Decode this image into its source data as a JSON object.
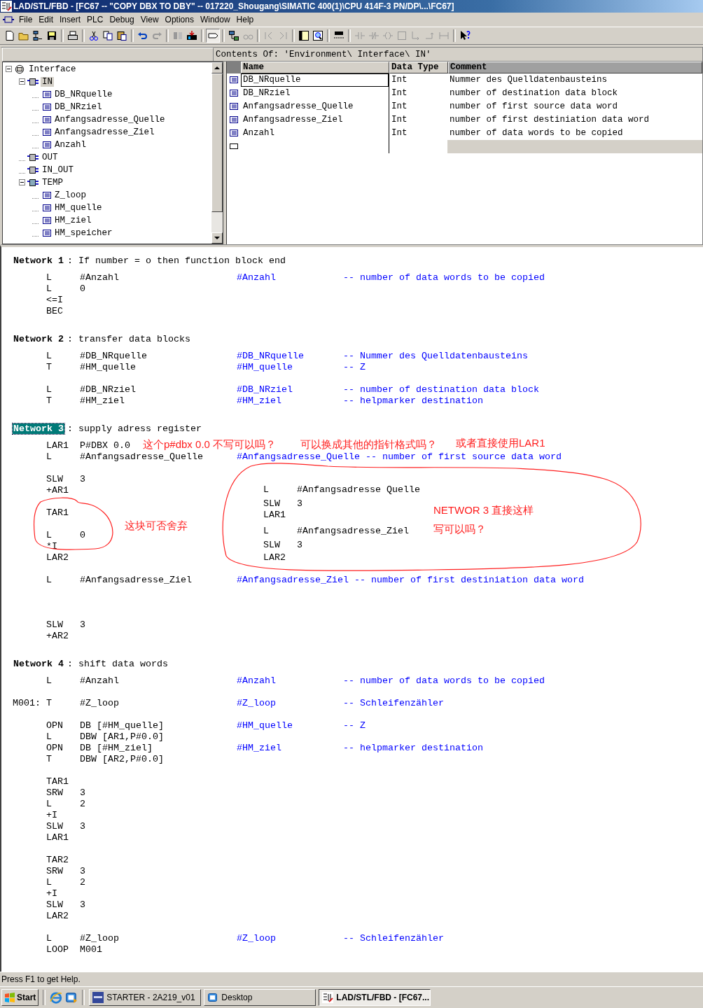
{
  "window": {
    "title": "LAD/STL/FBD  - [FC67 -- \"COPY DBX TO DBY\" -- 017220_Shougang\\SIMATIC 400(1)\\CPU 414F-3 PN/DP\\...\\FC67]"
  },
  "menu": [
    "File",
    "Edit",
    "Insert",
    "PLC",
    "Debug",
    "View",
    "Options",
    "Window",
    "Help"
  ],
  "contents_path": "Contents Of:  'Environment\\ Interface\\ IN'",
  "tree": {
    "label": "Interface",
    "kind": "root",
    "expanded": true,
    "selected": false,
    "children": [
      {
        "label": "IN",
        "kind": "section",
        "expanded": true,
        "selected": true,
        "children": [
          {
            "label": "DB_NRquelle",
            "kind": "param",
            "selected": false
          },
          {
            "label": "DB_NRziel",
            "kind": "param",
            "selected": false
          },
          {
            "label": "Anfangsadresse_Quelle",
            "kind": "param",
            "selected": false
          },
          {
            "label": "Anfangsadresse_Ziel",
            "kind": "param",
            "selected": false
          },
          {
            "label": "Anzahl",
            "kind": "param",
            "selected": false
          }
        ]
      },
      {
        "label": "OUT",
        "kind": "section",
        "selected": false
      },
      {
        "label": "IN_OUT",
        "kind": "section",
        "selected": false
      },
      {
        "label": "TEMP",
        "kind": "section",
        "expanded": true,
        "selected": false,
        "children": [
          {
            "label": "Z_loop",
            "kind": "param",
            "selected": false
          },
          {
            "label": "HM_quelle",
            "kind": "param",
            "selected": false
          },
          {
            "label": "HM_ziel",
            "kind": "param",
            "selected": false
          },
          {
            "label": "HM_speicher",
            "kind": "param",
            "selected": false
          }
        ]
      }
    ]
  },
  "table": {
    "columns": [
      "Name",
      "Data Type",
      "Comment"
    ],
    "rows": [
      {
        "name": "DB_NRquelle",
        "data_type": "Int",
        "comment": "Nummer des Quelldatenbausteins",
        "selected": true
      },
      {
        "name": "DB_NRziel",
        "data_type": "Int",
        "comment": "number of destination data block",
        "selected": false
      },
      {
        "name": "Anfangsadresse_Quelle",
        "data_type": "Int",
        "comment": "number of first source data word",
        "selected": false
      },
      {
        "name": "Anfangsadresse_Ziel",
        "data_type": "Int",
        "comment": "number of first destiniation data word",
        "selected": false
      },
      {
        "name": "Anzahl",
        "data_type": "Int",
        "comment": "number of data words to be copied",
        "selected": false
      }
    ]
  },
  "networks": [
    {
      "label": "Network 1",
      "title": ": If number = o then function block end",
      "selected": false,
      "lines": [
        {
          "kind": "code",
          "instruction": "L",
          "operand": "#Anzahl",
          "symbol": "#Anzahl",
          "comment": "-- number of data words to be copied"
        },
        {
          "kind": "code",
          "instruction": "L",
          "operand": "0"
        },
        {
          "kind": "code",
          "instruction": "<=I"
        },
        {
          "kind": "code",
          "instruction": "BEC"
        }
      ]
    },
    {
      "label": "Network 2",
      "title": ": transfer data blocks",
      "selected": false,
      "lines": [
        {
          "kind": "code",
          "instruction": "L",
          "operand": "#DB_NRquelle",
          "symbol": "#DB_NRquelle",
          "comment": "-- Nummer des Quelldatenbausteins"
        },
        {
          "kind": "code",
          "instruction": "T",
          "operand": "#HM_quelle",
          "symbol": "#HM_quelle",
          "comment": "-- Z"
        },
        {
          "kind": "blank"
        },
        {
          "kind": "code",
          "instruction": "L",
          "operand": "#DB_NRziel",
          "symbol": "#DB_NRziel",
          "comment": "-- number of destination data block"
        },
        {
          "kind": "code",
          "instruction": "T",
          "operand": "#HM_ziel",
          "symbol": "#HM_ziel",
          "comment": "-- helpmarker destination"
        }
      ]
    },
    {
      "label": "Network 3",
      "title": ": supply adress register",
      "selected": true,
      "lines": [
        {
          "kind": "code",
          "instruction": "LAR1",
          "operand": "P#DBX 0.0"
        },
        {
          "kind": "code",
          "instruction": "L",
          "operand": "#Anfangsadresse_Quelle",
          "symbol": "#Anfangsadresse_Quelle",
          "comment": "-- number of first source data word"
        },
        {
          "kind": "blank"
        },
        {
          "kind": "code",
          "instruction": "SLW",
          "operand": "3"
        },
        {
          "kind": "code",
          "instruction": "+AR1"
        },
        {
          "kind": "blank"
        },
        {
          "kind": "code",
          "instruction": "TAR1"
        },
        {
          "kind": "blank"
        },
        {
          "kind": "code",
          "instruction": "L",
          "operand": "0"
        },
        {
          "kind": "code",
          "instruction": "*I"
        },
        {
          "kind": "code",
          "instruction": "LAR2"
        },
        {
          "kind": "blank"
        },
        {
          "kind": "code",
          "instruction": "L",
          "operand": "#Anfangsadresse_Ziel",
          "symbol": "#Anfangsadresse_Ziel",
          "comment": "-- number of first destiniation data word"
        },
        {
          "kind": "blank"
        },
        {
          "kind": "blank"
        },
        {
          "kind": "blank"
        },
        {
          "kind": "code",
          "instruction": "SLW",
          "operand": "3"
        },
        {
          "kind": "code",
          "instruction": "+AR2"
        }
      ],
      "notes": [
        "这个p#dbx 0.0  不写可以吗？",
        "可以换成其他的指针格式吗？",
        "或者直接使用LAR1",
        "这块可否舍弃",
        "NETWOR 3  直接这样",
        "写可以吗？"
      ],
      "sketch_lines": [
        {
          "instruction": "L",
          "operand": "#Anfangsadresse Quelle"
        },
        {
          "instruction": "SLW",
          "operand": "3"
        },
        {
          "instruction": "LAR1"
        },
        {
          "instruction": "L",
          "operand": "#Anfangsadresse_Ziel"
        },
        {
          "instruction": "SLW",
          "operand": "3"
        },
        {
          "instruction": "LAR2"
        }
      ]
    },
    {
      "label": "Network 4",
      "title": ": shift data words",
      "selected": false,
      "lines": [
        {
          "kind": "code",
          "instruction": "L",
          "operand": "#Anzahl",
          "symbol": "#Anzahl",
          "comment": "-- number of data words to be copied"
        },
        {
          "kind": "blank"
        },
        {
          "kind": "code",
          "label": "M001:",
          "instruction": "T",
          "operand": "#Z_loop",
          "symbol": "#Z_loop",
          "comment": "-- Schleifenzähler"
        },
        {
          "kind": "blank"
        },
        {
          "kind": "code",
          "instruction": "OPN",
          "operand": "DB  [#HM_quelle]",
          "symbol": "#HM_quelle",
          "comment": "-- Z"
        },
        {
          "kind": "code",
          "instruction": "L",
          "operand": "DBW [AR1,P#0.0]"
        },
        {
          "kind": "code",
          "instruction": "OPN",
          "operand": "DB  [#HM_ziel]",
          "symbol": "#HM_ziel",
          "comment": "-- helpmarker destination"
        },
        {
          "kind": "code",
          "instruction": "T",
          "operand": "DBW [AR2,P#0.0]"
        },
        {
          "kind": "blank"
        },
        {
          "kind": "code",
          "instruction": "TAR1"
        },
        {
          "kind": "code",
          "instruction": "SRW",
          "operand": "3"
        },
        {
          "kind": "code",
          "instruction": "L",
          "operand": "2"
        },
        {
          "kind": "code",
          "instruction": "+I"
        },
        {
          "kind": "code",
          "instruction": "SLW",
          "operand": "3"
        },
        {
          "kind": "code",
          "instruction": "LAR1"
        },
        {
          "kind": "blank"
        },
        {
          "kind": "code",
          "instruction": "TAR2"
        },
        {
          "kind": "code",
          "instruction": "SRW",
          "operand": "3"
        },
        {
          "kind": "code",
          "instruction": "L",
          "operand": "2"
        },
        {
          "kind": "code",
          "instruction": "+I"
        },
        {
          "kind": "code",
          "instruction": "SLW",
          "operand": "3"
        },
        {
          "kind": "code",
          "instruction": "LAR2"
        },
        {
          "kind": "blank"
        },
        {
          "kind": "code",
          "instruction": "L",
          "operand": "#Z_loop",
          "symbol": "#Z_loop",
          "comment": "-- Schleifenzähler"
        },
        {
          "kind": "code",
          "instruction": "LOOP",
          "operand": "M001"
        }
      ]
    }
  ],
  "status_bar": "Press F1 to get Help.",
  "taskbar": {
    "start": "Start",
    "tasks": [
      {
        "label": "STARTER - 2A219_v01",
        "kind": "starter",
        "selected": false
      },
      {
        "label": "Desktop",
        "kind": "desktop",
        "selected": false
      },
      {
        "label": "LAD/STL/FBD  - [FC67...",
        "kind": "editor",
        "selected": true
      }
    ]
  }
}
